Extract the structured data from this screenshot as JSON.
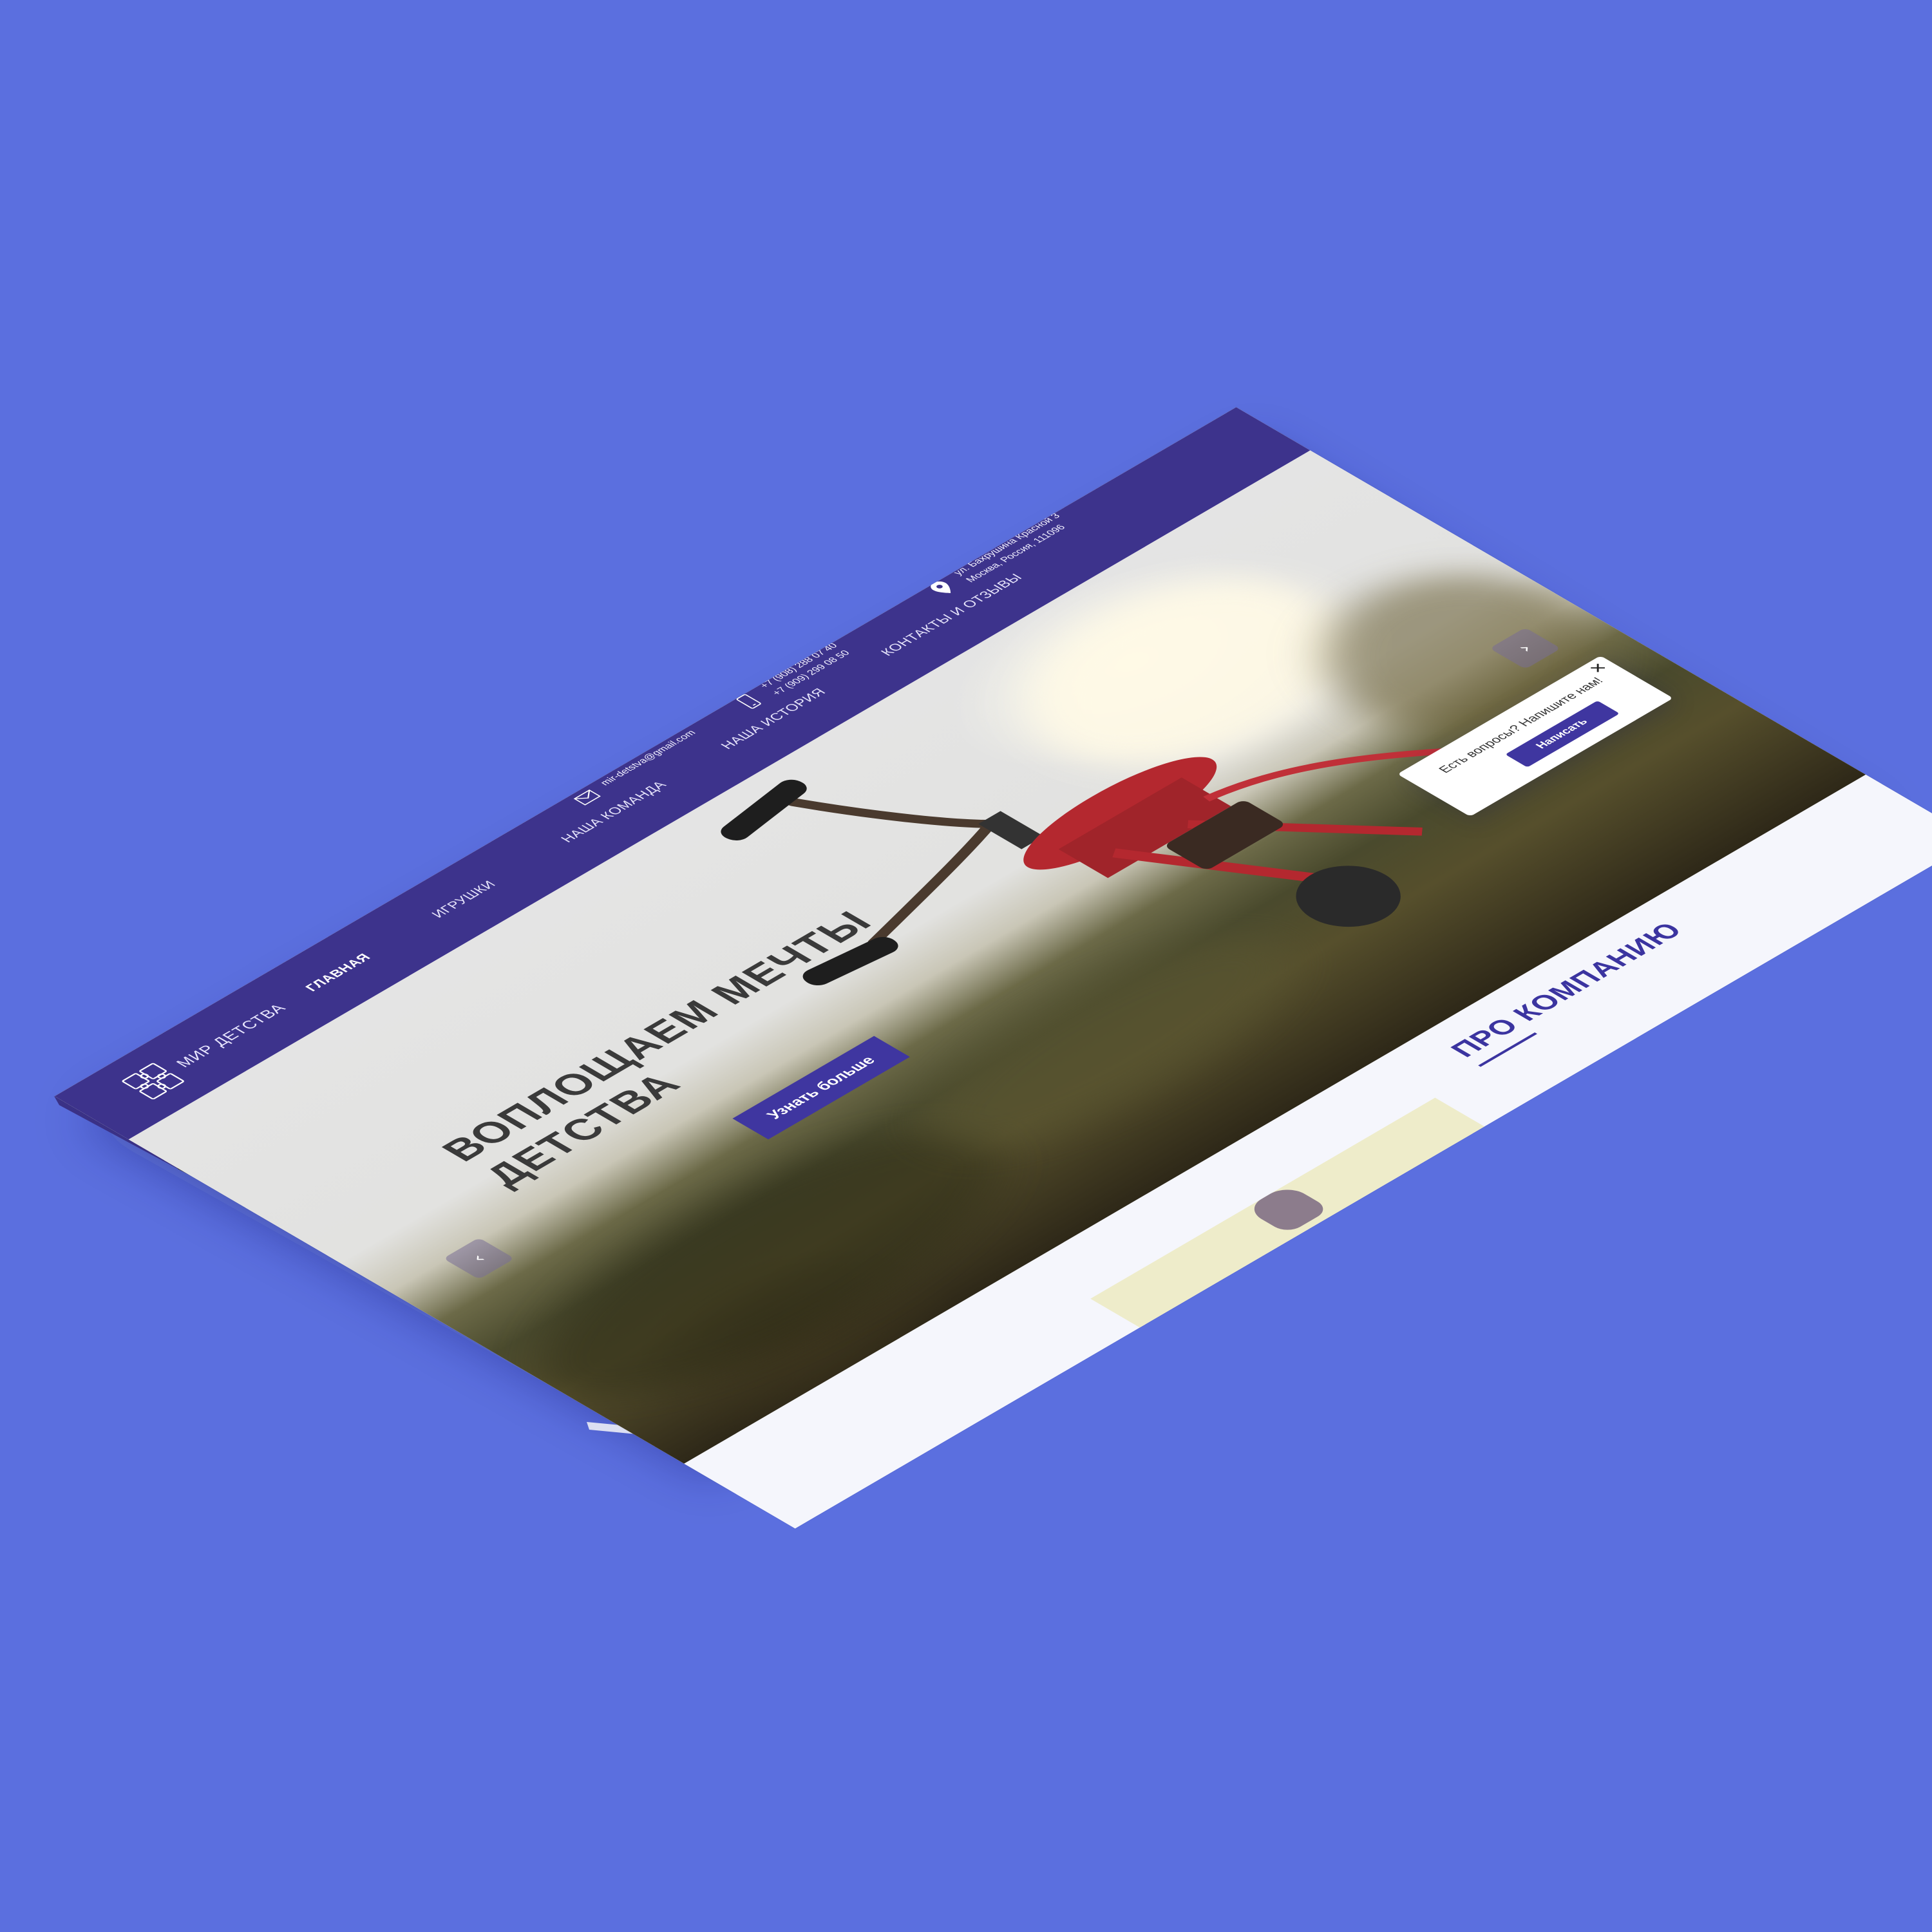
{
  "header": {
    "brand": "МИР ДЕТСТВА",
    "nav": [
      "ГЛАВНАЯ",
      "ИГРУШКИ",
      "НАША КОМАНДА",
      "НАША ИСТОРИЯ",
      "КОНТАКТЫ И ОТЗЫВЫ"
    ],
    "email": "mir-detstva@gmail.com",
    "phones": [
      "+7 (908) 288 07 40",
      "+7 (909) 299 08 50"
    ],
    "address": [
      "ул. Бахрушина Красной 3",
      "Москва, Россия, 111096"
    ]
  },
  "hero": {
    "title_line1": "ВОПЛОЩАЕМ МЕЧТЫ",
    "title_line2": "ДЕТСТВА",
    "cta_label": "Узнать больше",
    "prev_icon": "chevron-left-icon",
    "next_icon": "chevron-right-icon"
  },
  "about": {
    "title": "ПРО КОМПАНИЮ"
  },
  "chat": {
    "text": "Есть вопросы? Напишите нам!",
    "button_label": "Написать",
    "close_glyph": "✕"
  },
  "colors": {
    "background": "#5b6fdf",
    "header": "#3d338c",
    "accent": "#3f36a0",
    "bike_red": "#b4282f"
  }
}
